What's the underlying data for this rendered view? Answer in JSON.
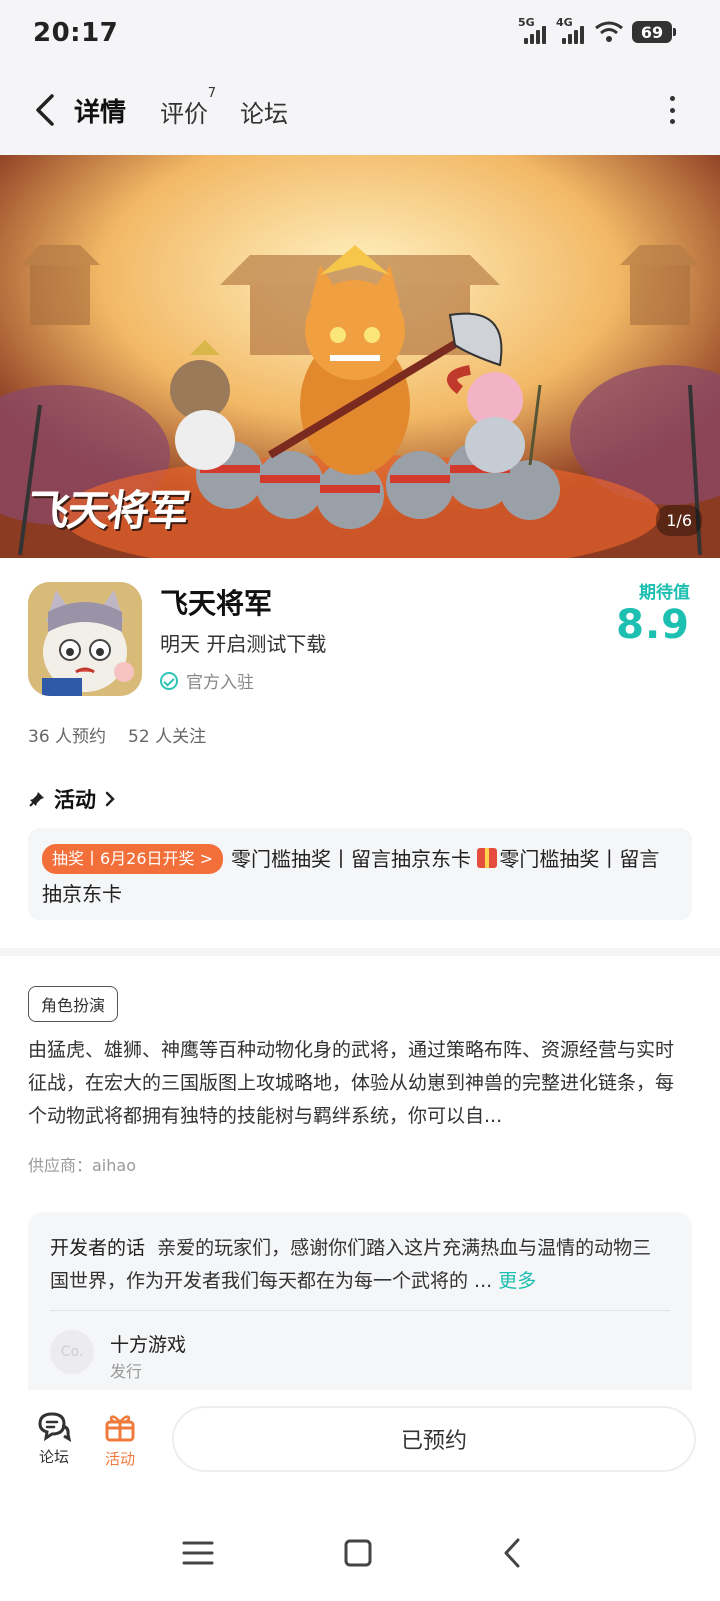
{
  "status_bar": {
    "time": "20:17",
    "signal1": "5G",
    "signal2": "4G",
    "battery": "69"
  },
  "nav": {
    "tabs": [
      {
        "label": "详情",
        "active": true
      },
      {
        "label": "评价",
        "badge": "7"
      },
      {
        "label": "论坛"
      }
    ]
  },
  "banner": {
    "logo_text": "飞天将军",
    "counter": "1/6"
  },
  "app": {
    "name": "飞天将军",
    "subtitle": "明天 开启测试下载",
    "official": "官方入驻",
    "expect_label": "期待值",
    "expect_value": "8.9",
    "reservations": "36 人预约",
    "followers": "52 人关注"
  },
  "activity": {
    "heading": "活动",
    "tag": "抽奖丨6月26日开奖 >",
    "text_a": "零门槛抽奖丨留言抽京东卡",
    "text_b": "零门槛抽奖丨留言抽京东卡"
  },
  "description": {
    "genre": "角色扮演",
    "text": "由猛虎、雄狮、神鹰等百种动物化身的武将，通过策略布阵、资源经营与实时征战，在宏大的三国版图上攻城略地，体验从幼崽到神兽的完整进化链条，每个动物武将都拥有独特的技能树与羁绊系统，你可以自...",
    "supplier": "供应商：aihao"
  },
  "developer": {
    "title": "开发者的话",
    "text": "亲爱的玩家们，感谢你们踏入这片充满热血与温情的动物三国世界，作为开发者我们每天都在为每一个武将的 ...",
    "more": "更多",
    "publisher_avatar": "Co.",
    "publisher_name": "十方游戏",
    "publisher_role": "发行"
  },
  "bottom_bar": {
    "forum_label": "论坛",
    "activity_label": "活动",
    "reserve_label": "已预约"
  },
  "colors": {
    "accent": "#1cbfb0",
    "tab_highlight": "#2fd3c1",
    "activity_orange": "#f36f3a"
  }
}
